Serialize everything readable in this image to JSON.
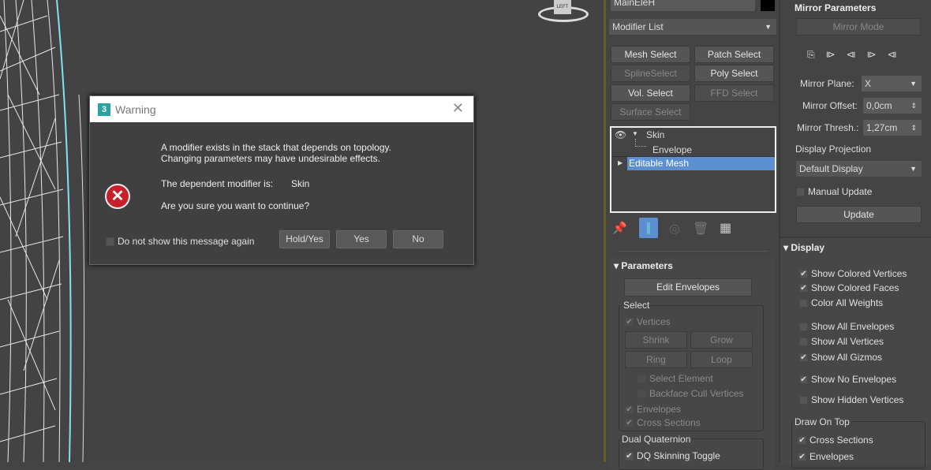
{
  "viewport": {
    "viewcube_label": "LEFT"
  },
  "dialog": {
    "title": "Warning",
    "line1": "A modifier exists in the stack that depends on topology.",
    "line2": "Changing parameters may have undesirable effects.",
    "dependent_label": "The dependent modifier is:",
    "dependent_value": "Skin",
    "question": "Are you sure you want to continue?",
    "checkbox_label": "Do not show this message again",
    "buttons": [
      "Hold/Yes",
      "Yes",
      "No"
    ]
  },
  "modify_panel": {
    "object_name": "MainEleH",
    "modifier_list": "Modifier List",
    "sets": [
      "Mesh Select",
      "Patch Select",
      "SplineSelect",
      "Poly Select",
      "Vol. Select",
      "FFD Select",
      "Surface Select"
    ],
    "stack": {
      "skin": "Skin",
      "envelope": "Envelope",
      "editable_mesh": "Editable Mesh"
    },
    "parameters": {
      "title": "Parameters",
      "edit_envelopes": "Edit Envelopes",
      "select_group": "Select",
      "vertices": "Vertices",
      "shrink": "Shrink",
      "grow": "Grow",
      "ring": "Ring",
      "loop": "Loop",
      "select_element": "Select Element",
      "backface_cull": "Backface Cull Vertices",
      "envelopes": "Envelopes",
      "cross_sections": "Cross Sections",
      "dq_group": "Dual Quaternion",
      "dq_toggle": "DQ Skinning Toggle"
    }
  },
  "mirror": {
    "title": "Mirror Parameters",
    "mirror_mode": "Mirror Mode",
    "plane_label": "Mirror Plane:",
    "plane_value": "X",
    "offset_label": "Mirror Offset:",
    "offset_value": "0,0cm",
    "thresh_label": "Mirror Thresh.:",
    "thresh_value": "1,27cm",
    "projection_label": "Display Projection",
    "projection_value": "Default Display",
    "manual_update": "Manual Update",
    "update": "Update"
  },
  "display": {
    "title": "Display",
    "items": [
      {
        "label": "Show Colored Vertices",
        "checked": true
      },
      {
        "label": "Show Colored Faces",
        "checked": true
      },
      {
        "label": "Color All Weights",
        "checked": false
      },
      {
        "label": "Show All Envelopes",
        "checked": false
      },
      {
        "label": "Show All Vertices",
        "checked": false
      },
      {
        "label": "Show All Gizmos",
        "checked": true
      },
      {
        "label": "Show No Envelopes",
        "checked": true
      },
      {
        "label": "Show Hidden Vertices",
        "checked": false
      }
    ],
    "draw_on_top": "Draw On Top",
    "draw_items": [
      "Cross Sections",
      "Envelopes"
    ]
  },
  "colors": {
    "selection": "#5b8fd0",
    "viewport": "#434343",
    "error": "#c8202a"
  }
}
